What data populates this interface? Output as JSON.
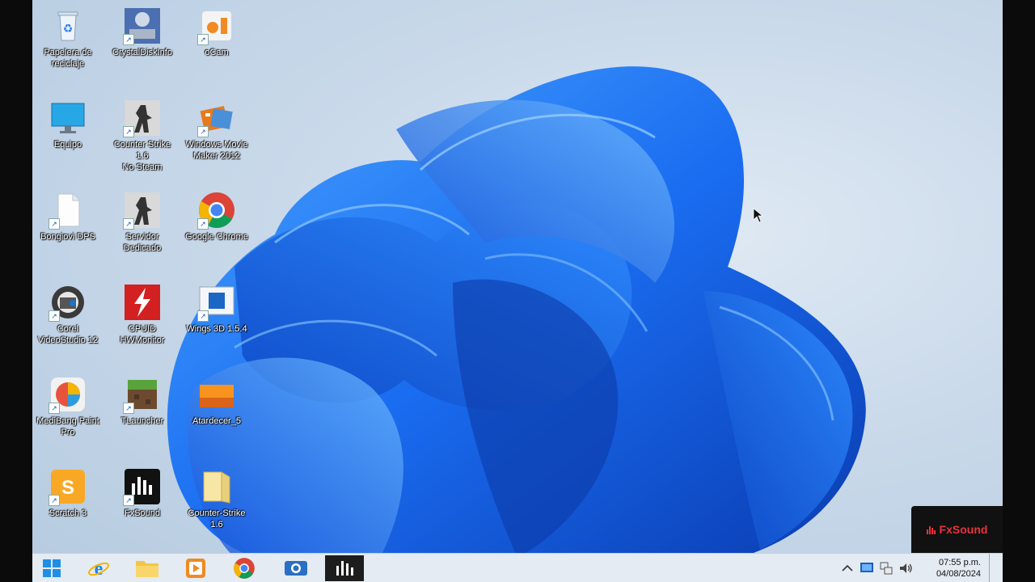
{
  "desktop": {
    "icons": [
      {
        "label": "Papelera de\nreciclaje",
        "icon": "recycle-bin-icon"
      },
      {
        "label": "CrystalDiskInfo",
        "icon": "crystaldiskinfo-icon"
      },
      {
        "label": "oCam",
        "icon": "ocam-icon"
      },
      {
        "label": "Equipo",
        "icon": "computer-icon"
      },
      {
        "label": "Counter Strike 1.6\nNo Steam",
        "icon": "counter-strike-icon"
      },
      {
        "label": "Windows Movie\nMaker 2012",
        "icon": "movie-maker-icon"
      },
      {
        "label": "Bongiovi DPS",
        "icon": "document-icon"
      },
      {
        "label": "Servidor\nDedicado",
        "icon": "counter-strike-server-icon"
      },
      {
        "label": "Google Chrome",
        "icon": "chrome-icon"
      },
      {
        "label": "Corel\nVideoStudio 12",
        "icon": "corel-videostudio-icon"
      },
      {
        "label": "CPUID\nHWMonitor",
        "icon": "hwmonitor-icon"
      },
      {
        "label": "Wings 3D 1.5.4",
        "icon": "wings3d-icon"
      },
      {
        "label": "MediBang Paint\nPro",
        "icon": "medibang-icon"
      },
      {
        "label": "TLauncher",
        "icon": "tlauncher-icon"
      },
      {
        "label": "Atardecer_5",
        "icon": "image-file-icon"
      },
      {
        "label": "Scratch 3",
        "icon": "scratch-icon"
      },
      {
        "label": "FxSound",
        "icon": "fxsound-icon"
      },
      {
        "label": "Counter-Strike\n1.6",
        "icon": "folder-icon"
      }
    ]
  },
  "fxsound_popup": {
    "brand": "FxSound",
    "color": "#e8333d"
  },
  "taskbar": {
    "buttons": [
      {
        "name": "start-button",
        "icon": "windows-start-icon"
      },
      {
        "name": "internet-explorer-button",
        "icon": "internet-explorer-icon"
      },
      {
        "name": "file-explorer-button",
        "icon": "folder-icon"
      },
      {
        "name": "media-player-button",
        "icon": "media-player-icon"
      },
      {
        "name": "chrome-button",
        "icon": "chrome-icon"
      },
      {
        "name": "screen-recorder-button",
        "icon": "camera-icon"
      },
      {
        "name": "fxsound-button",
        "icon": "fxsound-icon",
        "active": true
      }
    ],
    "tray": {
      "icons": [
        "chevron-up-icon",
        "network-monitor-icon",
        "network-icon",
        "speaker-icon"
      ],
      "time": "07:55 p.m.",
      "date": "04/08/2024"
    }
  },
  "colors": {
    "wallpaper_accent": "#1a6cf0",
    "taskbar_bg": "#e4ebf2"
  }
}
